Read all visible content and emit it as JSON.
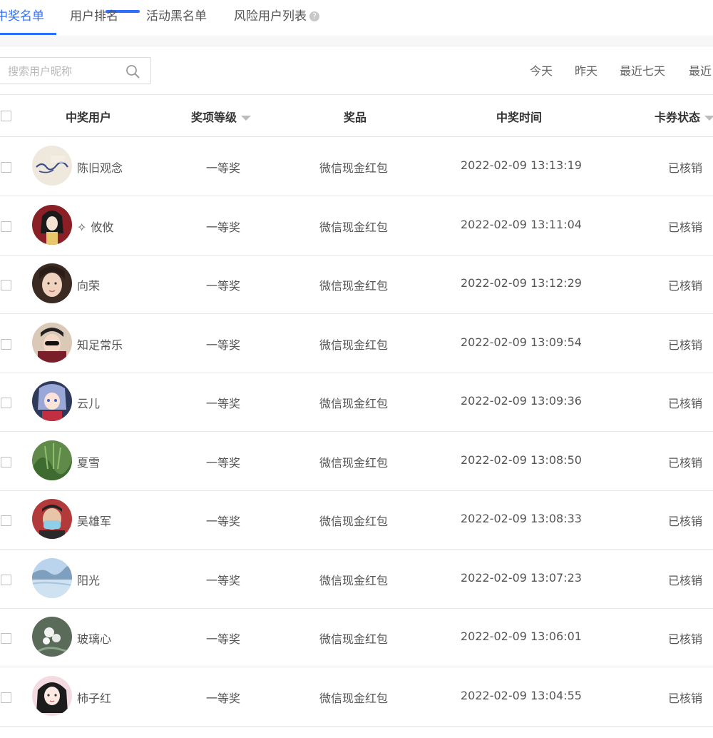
{
  "tabs": [
    {
      "label": "中奖名单"
    },
    {
      "label": "用户排名"
    },
    {
      "label": "活动黑名单"
    },
    {
      "label": "风险用户列表",
      "help": "?"
    }
  ],
  "search": {
    "placeholder": "搜索用户昵称",
    "value": ""
  },
  "filters": [
    "今天",
    "昨天",
    "最近七天",
    "最近"
  ],
  "table": {
    "columns": [
      "中奖用户",
      "奖项等级",
      "奖品",
      "中奖时间",
      "卡券状态"
    ],
    "rows": [
      {
        "nickname": "陈旧观念",
        "level": "一等奖",
        "prize": "微信现金红包",
        "time": "2022-02-09 13:13:19",
        "status": "已核销"
      },
      {
        "nickname": "攸攸",
        "level": "一等奖",
        "prize": "微信现金红包",
        "time": "2022-02-09 13:11:04",
        "status": "已核销"
      },
      {
        "nickname": "向荣",
        "level": "一等奖",
        "prize": "微信现金红包",
        "time": "2022-02-09 13:12:29",
        "status": "已核销"
      },
      {
        "nickname": "知足常乐",
        "level": "一等奖",
        "prize": "微信现金红包",
        "time": "2022-02-09 13:09:54",
        "status": "已核销"
      },
      {
        "nickname": "云儿",
        "level": "一等奖",
        "prize": "微信现金红包",
        "time": "2022-02-09 13:09:36",
        "status": "已核销"
      },
      {
        "nickname": "夏雪",
        "level": "一等奖",
        "prize": "微信现金红包",
        "time": "2022-02-09 13:08:50",
        "status": "已核销"
      },
      {
        "nickname": "吴雄军",
        "level": "一等奖",
        "prize": "微信现金红包",
        "time": "2022-02-09 13:08:33",
        "status": "已核销"
      },
      {
        "nickname": "阳光",
        "level": "一等奖",
        "prize": "微信现金红包",
        "time": "2022-02-09 13:07:23",
        "status": "已核销"
      },
      {
        "nickname": "玻璃心",
        "level": "一等奖",
        "prize": "微信现金红包",
        "time": "2022-02-09 13:06:01",
        "status": "已核销"
      },
      {
        "nickname": "柿子红",
        "level": "一等奖",
        "prize": "微信现金红包",
        "time": "2022-02-09 13:04:55",
        "status": "已核销"
      }
    ]
  },
  "colors": {
    "accent": "#2f6fff",
    "border": "#e6e6e6",
    "text": "#555555"
  }
}
